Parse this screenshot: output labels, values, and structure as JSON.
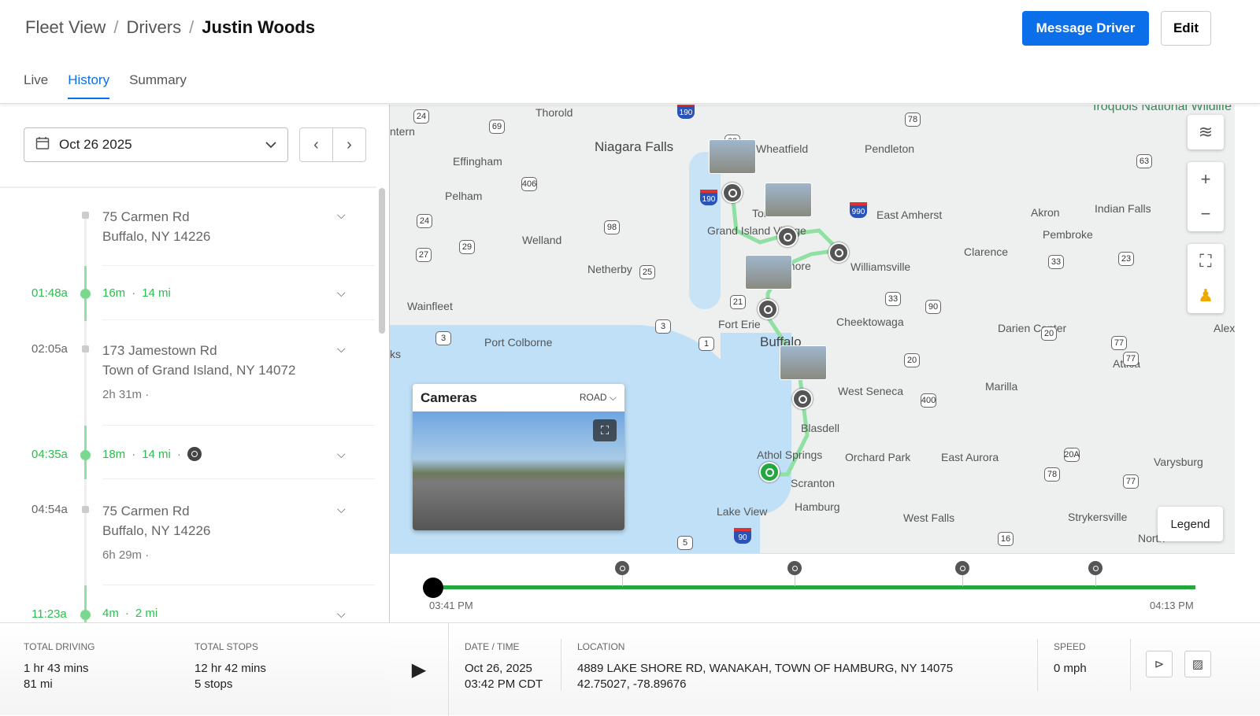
{
  "header": {
    "breadcrumb": [
      "Fleet View",
      "Drivers",
      "Justin Woods"
    ],
    "separator": "/",
    "message_button": "Message Driver",
    "edit_button": "Edit",
    "tabs": [
      {
        "label": "Live"
      },
      {
        "label": "History",
        "active": true
      },
      {
        "label": "Summary"
      }
    ]
  },
  "sidebar": {
    "date": "Oct 26 2025",
    "timeline": [
      {
        "type": "stop",
        "time": "",
        "address1": "75 Carmen Rd",
        "address2": "Buffalo, NY 14226",
        "duration": ""
      },
      {
        "type": "trip",
        "time": "01:48a",
        "duration": "16m",
        "distance": "14 mi"
      },
      {
        "type": "stop",
        "time": "02:05a",
        "address1": "173 Jamestown Rd",
        "address2": "Town of Grand Island, NY 14072",
        "duration": "2h 31m"
      },
      {
        "type": "trip",
        "time": "04:35a",
        "duration": "18m",
        "distance": "14 mi",
        "has_event": true
      },
      {
        "type": "stop",
        "time": "04:54a",
        "address1": "75 Carmen Rd",
        "address2": "Buffalo, NY 14226",
        "duration": "6h 29m"
      },
      {
        "type": "trip",
        "time": "11:23a",
        "duration": "4m",
        "distance": "2 mi"
      }
    ],
    "dot": "·",
    "totals": {
      "driving_label": "TOTAL DRIVING",
      "driving_time": "1 hr 43 mins",
      "driving_distance": "81 mi",
      "stops_label": "TOTAL STOPS",
      "stops_time": "12 hr 42 mins",
      "stops_count": "5 stops"
    }
  },
  "map": {
    "labels": [
      "Thorold",
      "Niagara Falls",
      "Wheatfield",
      "Pendleton",
      "Effingham",
      "Pelham",
      "Welland",
      "Netherby",
      "Tonawanda",
      "Grand Island Village",
      "Kenmore",
      "East Amherst",
      "Akron",
      "Indian Falls",
      "Pembroke",
      "Clarence",
      "Williamsville",
      "Wainfleet",
      "Fort Erie",
      "Buffalo",
      "Cheektowaga",
      "Port Colborne",
      "Darien Center",
      "West Seneca",
      "Marilla",
      "Attica",
      "Blasdell",
      "Athol Springs",
      "Orchard Park",
      "East Aurora",
      "Varysburg",
      "Scranton",
      "Hamburg",
      "Lake View",
      "West Falls",
      "Strykersville",
      "ntern",
      "ks",
      "Alexan",
      "North"
    ],
    "refuge": "Iroquois National Wildlife Refuge",
    "routes": [
      "24",
      "69",
      "190",
      "62",
      "78",
      "406",
      "190",
      "990",
      "63",
      "24",
      "98",
      "29",
      "27",
      "25",
      "90",
      "23",
      "21",
      "33",
      "77",
      "33",
      "3",
      "1",
      "3",
      "20",
      "20",
      "77",
      "400",
      "20A",
      "78",
      "77",
      "5",
      "90",
      "16"
    ],
    "legend_button": "Legend",
    "cameras": {
      "title": "Cameras",
      "view": "ROAD"
    }
  },
  "scrubber": {
    "start": "03:41 PM",
    "end": "04:13 PM",
    "progress": 0.0,
    "event_count": 4
  },
  "details": {
    "datetime_label": "DATE / TIME",
    "date": "Oct 26, 2025",
    "time": "03:42 PM CDT",
    "location_label": "LOCATION",
    "address": "4889 LAKE SHORE RD, WANAKAH, TOWN OF HAMBURG, NY 14075",
    "coords": "42.75027, -78.89676",
    "speed_label": "SPEED",
    "speed": "0 mph"
  },
  "colors": {
    "primary": "#0a6fe8",
    "trip_green": "#2dbd4e",
    "route_green": "#22a83f"
  }
}
